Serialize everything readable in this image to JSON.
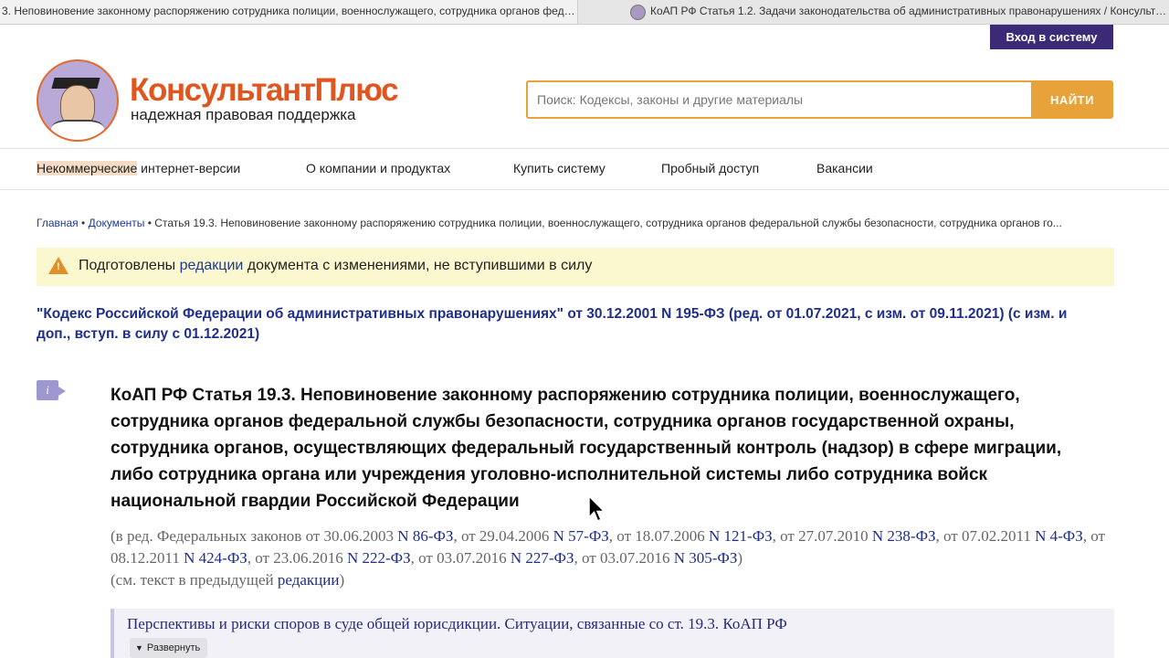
{
  "tabs": [
    {
      "title": "3. Неповиновение законному распоряжению сотрудника полиции, военнослужащего, сотрудника органов федерал..."
    },
    {
      "title": "КоАП РФ Статья 1.2. Задачи законодательства об административных правонарушениях / КонсультантПлюс"
    }
  ],
  "header": {
    "login_label": "Вход в систему",
    "brand_name": "КонсультантПлюс",
    "tagline": "надежная правовая поддержка",
    "search_placeholder": "Поиск: Кодексы, законы и другие материалы",
    "search_button": "НАЙТИ"
  },
  "nav": {
    "item1_highlight": "Некоммерческие",
    "item1_rest": " интернет-версии",
    "item2": "О компании и продуктах",
    "item3": "Купить систему",
    "item4": "Пробный доступ",
    "item5": "Вакансии"
  },
  "breadcrumb": {
    "home": "Главная",
    "sep1": " • ",
    "docs": "Документы",
    "sep2": " • ",
    "current": "Статья 19.3. Неповиновение законному распоряжению сотрудника полиции, военнослужащего, сотрудника органов федеральной службы безопасности, сотрудника органов го..."
  },
  "warning": {
    "before": "Подготовлены ",
    "link": "редакции",
    "after": " документа с изменениями, не вступившими в силу"
  },
  "document_link": "\"Кодекс Российской Федерации об административных правонарушениях\" от 30.12.2001 N 195-ФЗ (ред. от 01.07.2021, с изм. от 09.11.2021) (с изм. и доп., вступ. в силу с 01.12.2021)",
  "article": {
    "info_icon_glyph": "i",
    "title": "КоАП РФ Статья 19.3. Неповиновение законному распоряжению сотрудника полиции, военнослужащего, сотрудника органов федеральной службы безопасности, сотрудника органов государственной охраны, сотрудника органов, осуществляющих федеральный государственный контроль (надзор) в сфере миграции, либо сотрудника органа или учреждения уголовно-исполнительной системы либо сотрудника войск национальной гвардии Российской Федерации",
    "editions_prefix": "(в ред. Федеральных законов от ",
    "editions": [
      {
        "date": "30.06.2003",
        "law": "N 86-ФЗ"
      },
      {
        "date": "29.04.2006",
        "law": "N 57-ФЗ"
      },
      {
        "date": "18.07.2006",
        "law": "N 121-ФЗ"
      },
      {
        "date": "27.07.2010",
        "law": "N 238-ФЗ"
      },
      {
        "date": "07.02.2011",
        "law": "N 4-ФЗ"
      },
      {
        "date": "08.12.2011",
        "law": "N 424-ФЗ"
      },
      {
        "date": "23.06.2016",
        "law": "N 222-ФЗ"
      },
      {
        "date": "03.07.2016",
        "law": "N 227-ФЗ"
      },
      {
        "date": "03.07.2016",
        "law": "N 305-ФЗ"
      }
    ],
    "prev_text_before": "(см. текст в предыдущей ",
    "prev_text_link": "редакции",
    "prev_text_after": ")"
  },
  "perspectives": {
    "title": "Перспективы и риски споров в суде общей юрисдикции. Ситуации, связанные со ст. 19.3. КоАП РФ",
    "expand_label": "Развернуть"
  }
}
